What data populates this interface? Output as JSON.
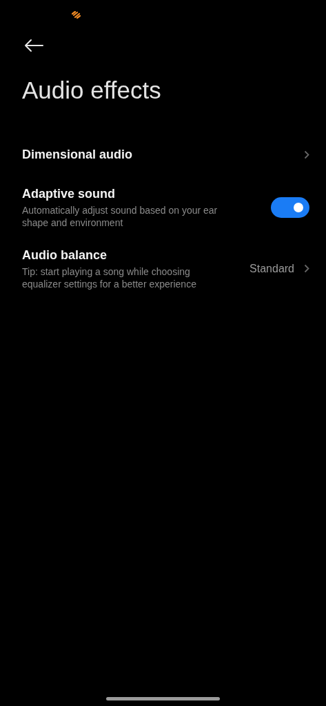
{
  "header": {
    "title": "Audio effects"
  },
  "items": [
    {
      "kind": "link",
      "title": "Dimensional audio"
    },
    {
      "kind": "toggle",
      "title": "Adaptive sound",
      "subtitle": "Automatically adjust sound based on your ear shape and environment",
      "on": true
    },
    {
      "kind": "link",
      "title": "Audio balance",
      "subtitle": "Tip: start playing a song while choosing equalizer settings for a better experience",
      "value": "Standard"
    }
  ]
}
